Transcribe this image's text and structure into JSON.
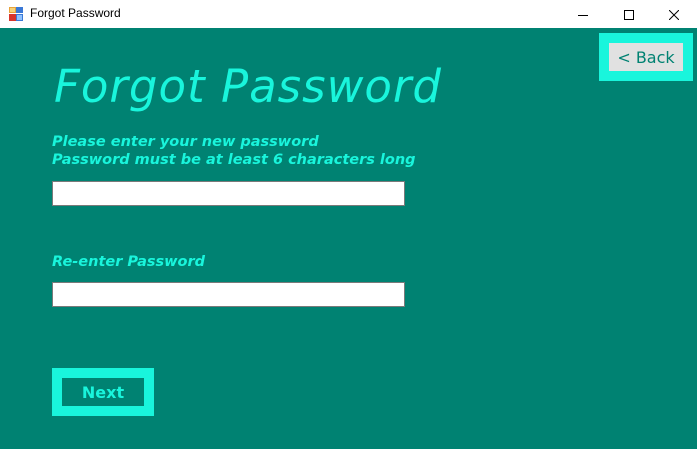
{
  "window": {
    "title": "Forgot Password",
    "icon": "windows-form-icon",
    "controls": {
      "minimize_icon": "minimize-icon",
      "maximize_icon": "maximize-icon",
      "close_icon": "close-icon"
    }
  },
  "colors": {
    "background": "#008272",
    "accent": "#19f5dc",
    "back_button_face": "#e1e1e1"
  },
  "form": {
    "heading": "Forgot Password",
    "new_password_label_line1": "Please enter your new password",
    "new_password_label_line2": "Password must be at least 6 characters long",
    "new_password_value": "",
    "reenter_label": "Re-enter Password",
    "reenter_value": "",
    "next_label": "Next",
    "back_label": "< Back"
  }
}
